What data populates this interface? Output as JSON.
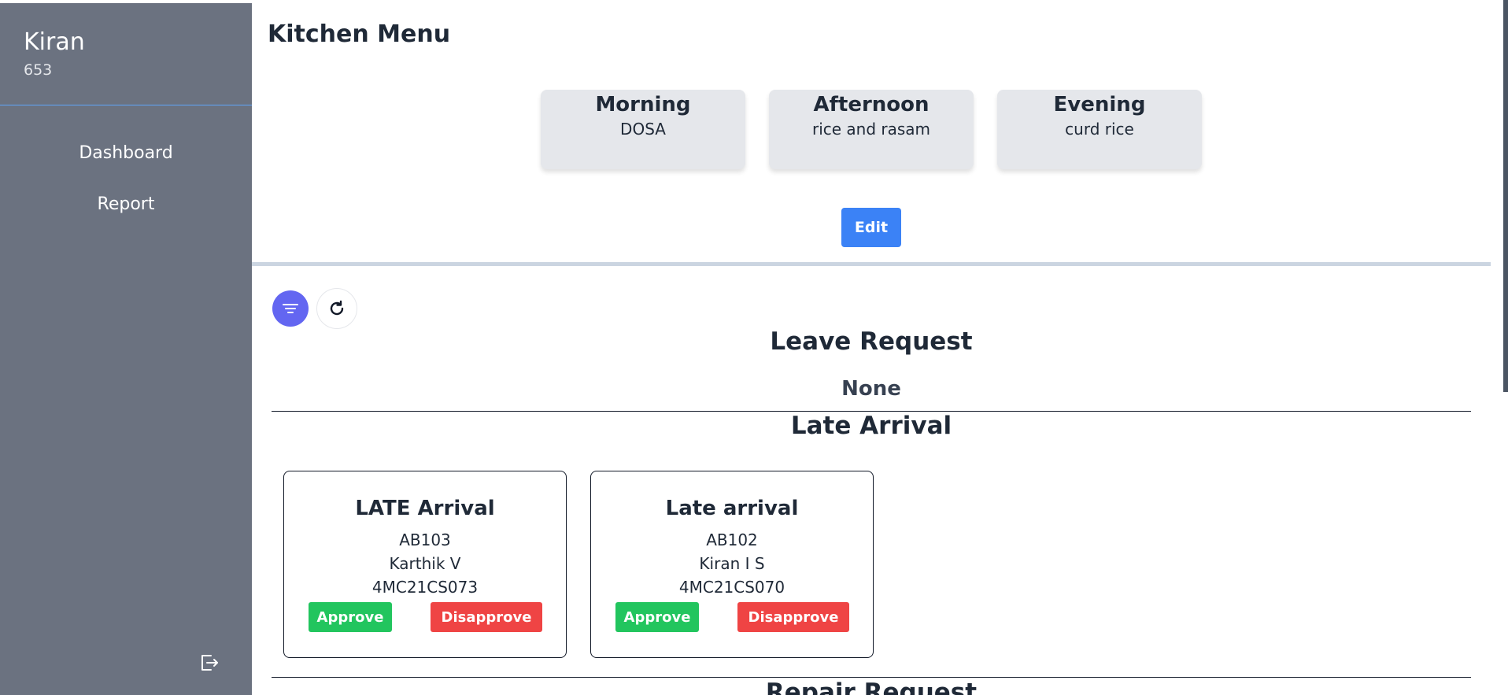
{
  "user": {
    "name": "Kiran",
    "id": "653"
  },
  "nav": [
    {
      "label": "Dashboard"
    },
    {
      "label": "Report"
    }
  ],
  "page_title": "Kitchen Menu",
  "menu": [
    {
      "slot": "Morning",
      "dish": "DOSA"
    },
    {
      "slot": "Afternoon",
      "dish": "rice and rasam"
    },
    {
      "slot": "Evening",
      "dish": "curd rice"
    }
  ],
  "edit_label": "Edit",
  "leave_request": {
    "title": "Leave Request",
    "empty_text": "None"
  },
  "late_arrival": {
    "title": "Late Arrival",
    "requests": [
      {
        "title": "LATE Arrival",
        "room": "AB103",
        "name": "Karthik V",
        "usn": "4MC21CS073"
      },
      {
        "title": "Late arrival",
        "room": "AB102",
        "name": "Kiran I S",
        "usn": "4MC21CS070"
      }
    ],
    "approve_label": "Approve",
    "disapprove_label": "Disapprove"
  },
  "repair_request": {
    "title": "Repair Request"
  },
  "icons": {
    "filter": "filter-icon",
    "refresh": "refresh-icon",
    "logout": "logout-icon"
  },
  "colors": {
    "sidebar": "#6b7280",
    "primary": "#3b82f6",
    "filter": "#6366f1",
    "approve": "#22c55e",
    "disapprove": "#ef4444"
  }
}
